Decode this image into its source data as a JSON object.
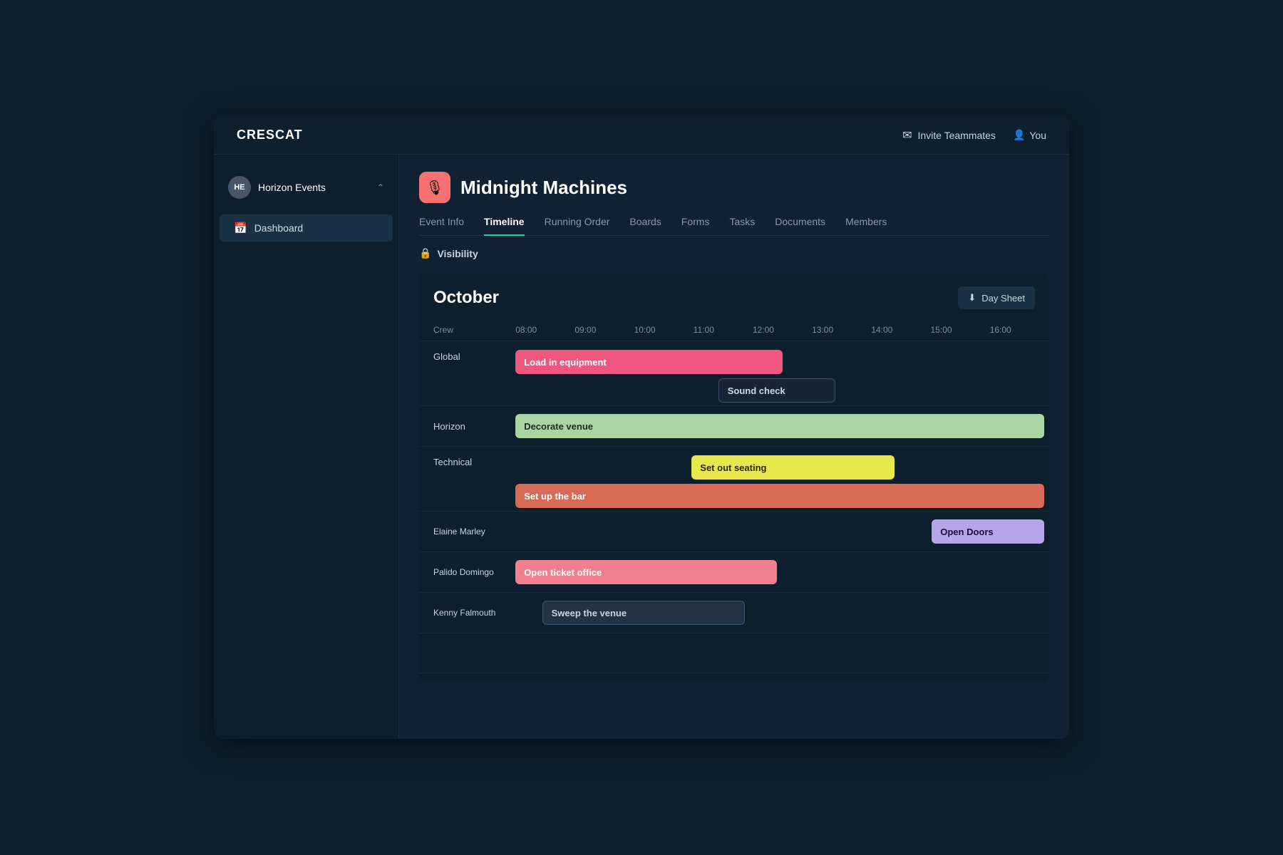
{
  "brand": "CRESCAT",
  "topNav": {
    "inviteLabel": "Invite Teammates",
    "userLabel": "You"
  },
  "sidebar": {
    "org": {
      "initials": "HE",
      "name": "Horizon Events"
    },
    "items": [
      {
        "id": "dashboard",
        "label": "Dashboard",
        "active": true
      }
    ]
  },
  "event": {
    "icon": "🎙",
    "title": "Midnight Machines",
    "tabs": [
      {
        "id": "event-info",
        "label": "Event Info",
        "active": false
      },
      {
        "id": "timeline",
        "label": "Timeline",
        "active": true
      },
      {
        "id": "running-order",
        "label": "Running Order",
        "active": false
      },
      {
        "id": "boards",
        "label": "Boards",
        "active": false
      },
      {
        "id": "forms",
        "label": "Forms",
        "active": false
      },
      {
        "id": "tasks",
        "label": "Tasks",
        "active": false
      },
      {
        "id": "documents",
        "label": "Documents",
        "active": false
      },
      {
        "id": "members",
        "label": "Members",
        "active": false
      }
    ],
    "visibility": "Visibility"
  },
  "timeline": {
    "month": "October",
    "daySheetLabel": "Day Sheet",
    "timeHeaders": [
      "Crew",
      "08:00",
      "09:00",
      "10:00",
      "11:00",
      "12:00",
      "13:00",
      "14:00",
      "15:00",
      "16:00"
    ],
    "rows": [
      {
        "id": "global",
        "label": "Global",
        "bars": [
          {
            "label": "Load in equipment",
            "color": "#f0567e",
            "textColor": "#fff",
            "startCol": 0,
            "span": 4.5,
            "topOffset": 8
          },
          {
            "label": "Sound check",
            "color": "#1e2d3e",
            "textColor": "#cdd8e3",
            "border": "1px solid #3a5068",
            "startCol": 3.5,
            "span": 2,
            "topOffset": 46
          }
        ]
      },
      {
        "id": "horizon",
        "label": "Horizon",
        "bars": [
          {
            "label": "Decorate venue",
            "color": "#a8d5a2",
            "textColor": "#1a2e1a",
            "startCol": 0,
            "span": 9
          }
        ]
      },
      {
        "id": "technical",
        "label": "Technical",
        "bars": [
          {
            "label": "Set out seating",
            "color": "#e8e84a",
            "textColor": "#2a2a00",
            "startCol": 3,
            "span": 3.5,
            "topOffset": 8
          },
          {
            "label": "Set up the bar",
            "color": "#e07060",
            "textColor": "#fff",
            "startCol": 0,
            "span": 9,
            "topOffset": 46
          }
        ]
      },
      {
        "id": "elaine",
        "label": "Elaine Marley",
        "bars": [
          {
            "label": "Open Doors",
            "color": "#b8a4e8",
            "textColor": "#1a0a3a",
            "startCol": 7,
            "span": 2
          }
        ]
      },
      {
        "id": "palido",
        "label": "Palido Domingo",
        "bars": [
          {
            "label": "Open ticket office",
            "color": "#f08090",
            "textColor": "#fff",
            "startCol": 0,
            "span": 4.5
          }
        ]
      },
      {
        "id": "kenny",
        "label": "Kenny Falmouth",
        "bars": [
          {
            "label": "Sweep the venue",
            "color": "#2a3d52",
            "textColor": "#c5d4e0",
            "border": "1px solid #3a5570",
            "startCol": 0.5,
            "span": 3.5
          }
        ]
      }
    ]
  }
}
